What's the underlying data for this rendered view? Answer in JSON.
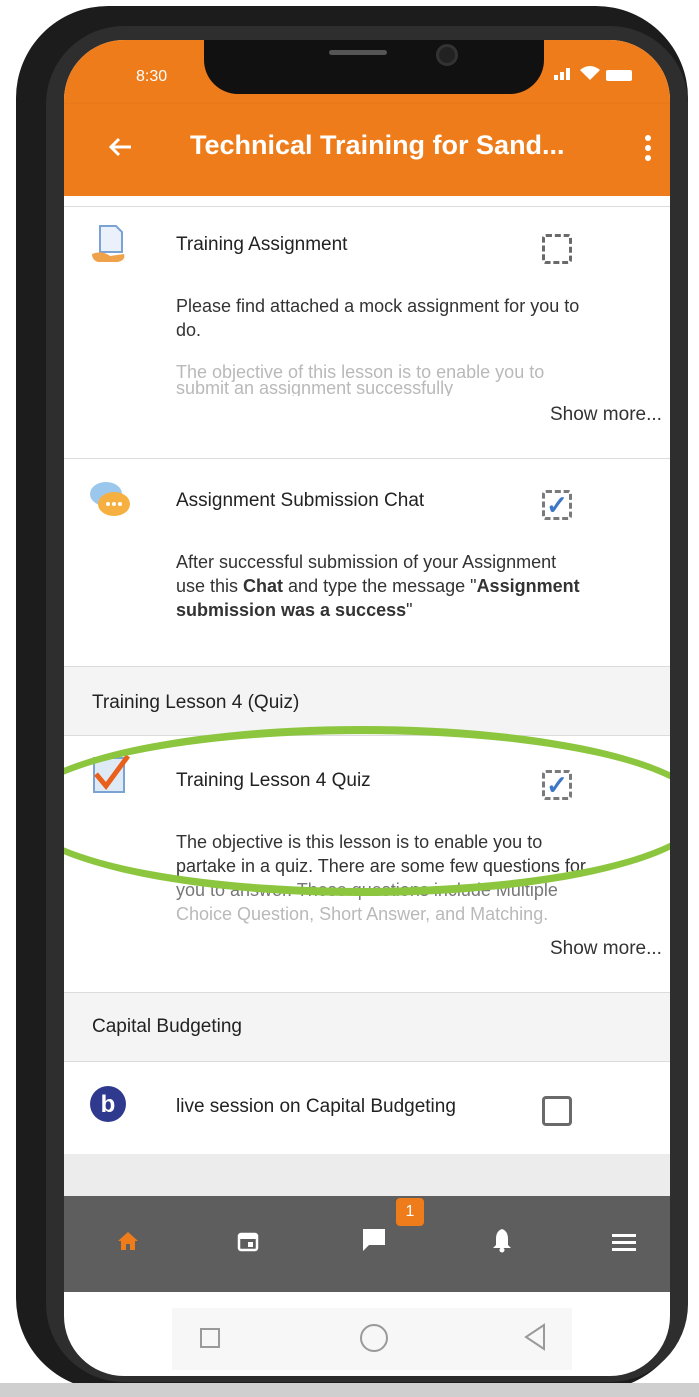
{
  "status_bar": {
    "time": "8:30",
    "signal_icon": "signal-icon",
    "wifi_icon": "wifi-icon",
    "battery_icon": "battery-icon"
  },
  "app_bar": {
    "back_icon": "arrow-left-icon",
    "title": "Technical Training for Sand...",
    "menu_icon": "more-vert-icon",
    "color": "#ef7c1a"
  },
  "activities": {
    "training_assignment": {
      "title": "Training Assignment",
      "desc_line1": "Please find attached a mock assignment for you to",
      "desc_line2": "do.",
      "desc_faded1": "The objective of this lesson is to enable you to",
      "desc_faded2": "submit an assignment successfully",
      "show_more": "Show more...",
      "completion": "incomplete-auto"
    },
    "submission_chat": {
      "title": "Assignment Submission Chat",
      "desc_line1": "After successful submission of your Assignment",
      "desc_line2_a": "use this ",
      "desc_line2_b": "Chat",
      "desc_line2_c": "  and type the message \"",
      "desc_line2_d": "Assignment",
      "desc_line3_a": "submission was a success",
      "desc_line3_b": "\"",
      "completion": "complete"
    }
  },
  "sections": {
    "lesson4": {
      "heading": "Training Lesson 4 (Quiz)",
      "quiz": {
        "title": "Training Lesson 4 Quiz",
        "desc_line1": "The objective is this lesson is to enable you to",
        "desc_line2": "partake in a quiz. There are some few questions for",
        "desc_line3": "you to answer. These questions include Multiple",
        "desc_line4": "Choice Question, Short Answer, and Matching.",
        "show_more": "Show more...",
        "completion": "complete"
      }
    },
    "capital_budgeting": {
      "heading": "Capital Budgeting",
      "live": {
        "title": "live session on Capital Budgeting",
        "completion": "incomplete-manual"
      }
    }
  },
  "bottom_nav": {
    "items": [
      "home-icon",
      "calendar-icon",
      "messages-icon",
      "bell-icon",
      "menu-icon"
    ],
    "messages_badge": "1",
    "active": "home"
  },
  "highlight_color": "#8cc63f"
}
